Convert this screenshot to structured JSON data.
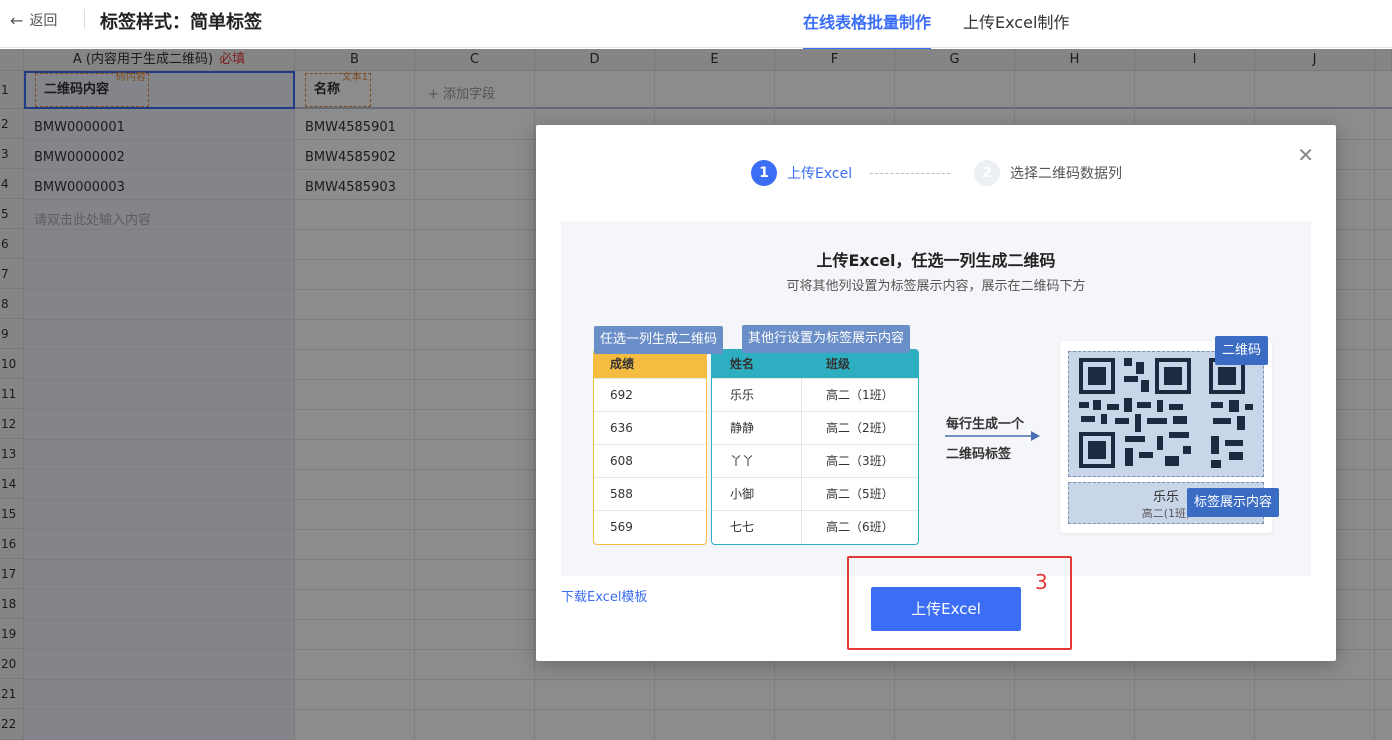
{
  "header": {
    "back_label": "返回",
    "title": "标签样式：简单标签",
    "tabs": [
      {
        "label": "在线表格批量制作",
        "active": true
      },
      {
        "label": "上传Excel制作",
        "active": false
      }
    ]
  },
  "sheet": {
    "columns": [
      "A (内容用于生成二维码)",
      "B",
      "C",
      "D",
      "E",
      "F",
      "G",
      "H",
      "I",
      "J"
    ],
    "required_label": "必填",
    "row_numbers": [
      "1",
      "2",
      "3",
      "4",
      "5",
      "6",
      "7",
      "8",
      "9",
      "10",
      "11",
      "12",
      "13",
      "14",
      "15",
      "16",
      "17",
      "18",
      "19",
      "20",
      "21",
      "22"
    ],
    "fields": [
      {
        "name": "二维码内容",
        "tag": "码内容"
      },
      {
        "name": "名称",
        "tag": "文本1"
      }
    ],
    "add_field_label": "+ 添加字段",
    "rows": [
      {
        "a": "BMW0000001",
        "b": "BMW4585901"
      },
      {
        "a": "BMW0000002",
        "b": "BMW4585902"
      },
      {
        "a": "BMW0000003",
        "b": "BMW4585903"
      }
    ],
    "input_hint": "请双击此处输入内容"
  },
  "modal": {
    "close_icon": "close-icon",
    "steps": [
      {
        "num": "1",
        "label": "上传Excel"
      },
      {
        "num": "2",
        "label": "选择二维码数据列"
      }
    ],
    "panel": {
      "title": "上传Excel，任选一列生成二维码",
      "subtitle": "可将其他列设置为标签展示内容，展示在二维码下方",
      "callout_left": "任选一列生成二维码",
      "callout_right": "其他行设置为标签展示内容",
      "score_header": "成绩",
      "scores": [
        "692",
        "636",
        "608",
        "588",
        "569"
      ],
      "name_header": "姓名",
      "class_header": "班级",
      "students": [
        {
          "name": "乐乐",
          "class": "高二（1班）"
        },
        {
          "name": "静静",
          "class": "高二（2班）"
        },
        {
          "name": "丫丫",
          "class": "高二（3班）"
        },
        {
          "name": "小御",
          "class": "高二（5班）"
        },
        {
          "name": "七七",
          "class": "高二（6班）"
        }
      ],
      "arrow_line1": "每行生成一个",
      "arrow_line2": "二维码标签",
      "qr_badge": "二维码",
      "label_badge": "标签展示内容",
      "label_name": "乐乐",
      "label_class": "高二(1班)"
    },
    "download_link": "下载Excel模板",
    "upload_button": "上传Excel"
  },
  "annotation": {
    "number": "3",
    "color": "#e53935"
  },
  "colors": {
    "accent": "#3b6ef5",
    "score_header_bg": "#f5bc42",
    "info_header_bg": "#2eaec1"
  }
}
